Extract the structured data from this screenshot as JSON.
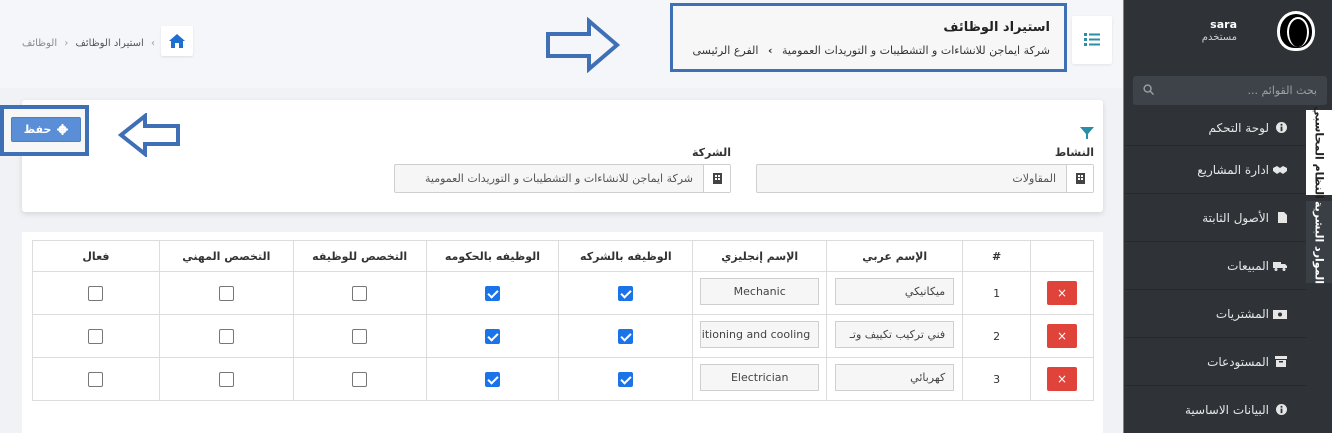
{
  "sidebar": {
    "user_name": "sara",
    "user_role": "مستخدم",
    "search_placeholder": "بحث القوائم ...",
    "items": [
      {
        "label": "لوحة التحكم",
        "icon": "info-circle-icon"
      },
      {
        "label": "ادارة المشاريع",
        "icon": "handshake-icon"
      },
      {
        "label": "الأصول الثابتة",
        "icon": "file-icon"
      },
      {
        "label": "المبيعات",
        "icon": "truck-icon"
      },
      {
        "label": "المشتريات",
        "icon": "money-icon"
      },
      {
        "label": "المستودعات",
        "icon": "archive-icon"
      },
      {
        "label": "البيانات الاساسية",
        "icon": "info-circle-icon"
      }
    ],
    "vertical_tabs": [
      "النظام المحاسبي",
      "الموارد البشرية"
    ]
  },
  "header": {
    "title": "استيراد الوظائف",
    "subtitle_company": "شركة ايماجن للانشاءات و التشطيبات و التوريدات العمومية",
    "subtitle_branch": "الفرع الرئيسى",
    "breadcrumb": [
      "الوظائف",
      "استيراد الوظائف"
    ]
  },
  "form": {
    "save_label": "حفظ",
    "activity_label": "النشاط",
    "activity_value": "المقاولات",
    "company_label": "الشركة",
    "company_value": "شركة ايماجن للانشاءات و التشطيبات و التوريدات العمومية"
  },
  "table": {
    "headers": [
      "#",
      "الإسم عربي",
      "الإسم إنجليزي",
      "الوظيفه بالشركه",
      "الوظيفه بالحكومه",
      "التخصص للوظيفه",
      "التخصص المهني",
      "فعال"
    ],
    "rows": [
      {
        "num": "1",
        "arabic": "ميكانيكي",
        "english": "Mechanic",
        "company_job": true,
        "gov_job": true,
        "job_spec": false,
        "prof_spec": false,
        "active": false
      },
      {
        "num": "2",
        "arabic": "فني تركيب تكييف وتـ",
        "english": "litioning and cooling",
        "company_job": true,
        "gov_job": true,
        "job_spec": false,
        "prof_spec": false,
        "active": false
      },
      {
        "num": "3",
        "arabic": "كهربائي",
        "english": "Electrician",
        "company_job": true,
        "gov_job": true,
        "job_spec": false,
        "prof_spec": false,
        "active": false
      }
    ],
    "delete_symbol": "×"
  },
  "colors": {
    "sidebar_bg": "#2f3338",
    "highlight_frame": "#3f6fb5",
    "save_button": "#5a8fd8",
    "delete_button": "#e0433a",
    "checkbox_checked": "#1a73e8"
  }
}
